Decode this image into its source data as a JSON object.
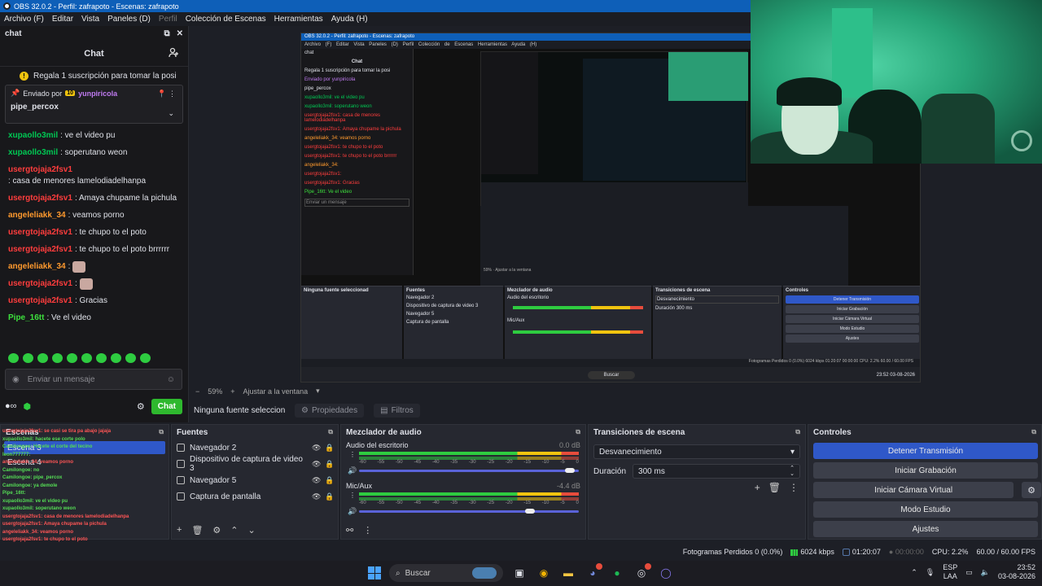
{
  "window": {
    "title": "OBS 32.0.2 - Perfil: zafrapoto - Escenas: zafrapoto"
  },
  "menu": [
    "Archivo (F)",
    "Editar",
    "Vista",
    "Paneles (D)",
    "Perfil",
    "Colección de Escenas",
    "Herramientas",
    "Ayuda (H)"
  ],
  "chat": {
    "dock_title": "chat",
    "header": "Chat",
    "gift_text": "Regala 1 suscripción para tomar la posi",
    "pinned": {
      "label": "Enviado por",
      "sub_badge": "10",
      "by": "yunpiricola",
      "user": "pipe_percox"
    },
    "messages": [
      {
        "user": "xupaollo3mil",
        "color": "#00c853",
        "text": ": ve el video pu"
      },
      {
        "user": "xupaollo3mil",
        "color": "#00c853",
        "text": ": soperutano weon"
      },
      {
        "user": "usergtojaja2fsv1",
        "color": "#ff3d3d",
        "text": ": casa de menores lamelodiadelhanpa"
      },
      {
        "user": "usergtojaja2fsv1",
        "color": "#ff3d3d",
        "text": ": Amaya chupame la pichula"
      },
      {
        "user": "angeleliakk_34",
        "color": "#ff9a2e",
        "text": ": veamos porno"
      },
      {
        "user": "usergtojaja2fsv1",
        "color": "#ff3d3d",
        "text": ": te chupo to el poto"
      },
      {
        "user": "usergtojaja2fsv1",
        "color": "#ff3d3d",
        "text": ": te chupo to el poto brrrrrr"
      },
      {
        "user": "angeleliakk_34",
        "color": "#ff9a2e",
        "text": ":",
        "emote": true
      },
      {
        "user": "usergtojaja2fsv1",
        "color": "#ff3d3d",
        "text": ":",
        "emote": true
      },
      {
        "user": "usergtojaja2fsv1",
        "color": "#ff3d3d",
        "text": ": Gracias"
      },
      {
        "user": "Pipe_16tt",
        "color": "#3de03d",
        "text": ": Ve el video"
      }
    ],
    "input_placeholder": "Enviar un mensaje",
    "chat_button": "Chat"
  },
  "zoom": {
    "value": "59%",
    "fit_label": "Ajustar a la ventana"
  },
  "context_bar": {
    "no_source": "Ninguna fuente seleccionad",
    "properties": "Propiedades",
    "filters": "Filtros"
  },
  "scenes": {
    "title": "Escenas",
    "items": [
      "Escena 3",
      "Escena 4"
    ],
    "selected": 0
  },
  "sources": {
    "title": "Fuentes",
    "items": [
      "Navegador 2",
      "Dispositivo de captura de video 3",
      "Navegador 5",
      "Captura de pantalla"
    ]
  },
  "mixer": {
    "title": "Mezclador de audio",
    "tracks": [
      {
        "name": "Audio del escritorio",
        "db": "0.0 dB",
        "level": 0.72,
        "volume": 0.98
      },
      {
        "name": "Mic/Aux",
        "db": "-4.4 dB",
        "level": 0.88,
        "volume": 0.8
      }
    ],
    "ticks": [
      "-60",
      "-55",
      "-50",
      "-45",
      "-40",
      "-35",
      "-30",
      "-25",
      "-20",
      "-15",
      "-10",
      "-5",
      "0"
    ]
  },
  "transitions": {
    "title": "Transiciones de escena",
    "selected": "Desvanecimiento",
    "duration_label": "Duración",
    "duration_value": "300 ms"
  },
  "controls": {
    "title": "Controles",
    "buttons": [
      "Detener Transmisión",
      "Iniciar Grabación",
      "Iniciar Cámara Virtual",
      "Modo Estudio",
      "Ajustes"
    ]
  },
  "status": {
    "dropped": "Fotogramas Perdidos 0 (0.0%)",
    "bitrate": "6024 kbps",
    "stream_time": "01:20:07",
    "rec_time": "00:00:00",
    "cpu": "CPU: 2.2%",
    "fps": "60.00 / 60.00 FPS"
  },
  "taskbar": {
    "search": "Buscar",
    "lang_top": "ESP",
    "lang_bottom": "LAA",
    "time": "23:52",
    "date": "03-08-2026"
  },
  "nested": {
    "title": "OBS 32.0.2 - Perfil: zafrapoto - Escenas: zafrapoto",
    "menu": "Archivo (F) Editar Vista Paneles (D) Perfil Colección de Escenas Herramientas Ayuda (H)",
    "chat_lines": [
      "chat",
      "Chat",
      "Regala 1 suscripción para tomar la posi",
      "Enviado por yunpiricola",
      "pipe_percox",
      "xupaollo3mil: ve el video pu",
      "xupaollo3mil: soperutano weon",
      "usergtojaja2fsv1: casa de menores lamelodiadelhanpa",
      "usergtojaja2fsv1: Amaya chupame la pichula",
      "angeleliakk_34: veamos porno",
      "usergtojaja2fsv1: te chupo to el poto",
      "usergtojaja2fsv1: te chupo to el poto brrrrrr",
      "angeleliakk_34:",
      "usergtojaja2fsv1:",
      "usergtojaja2fsv1: Gracias",
      "Pipe_16tt: Ve el video",
      "Enviar un mensaje"
    ],
    "zoom": "59%",
    "fit_label": "Ajustar a la ventana",
    "no_source": "Ninguna fuente seleccionad",
    "properties": "Propiedades",
    "filters": "Filtros",
    "sources_title": "Fuentes",
    "sources": [
      "Navegador 2",
      "Dispositivo de captura de video 3",
      "Navegador 5",
      "Captura de pantalla"
    ],
    "mixer_title": "Mezclador de audio",
    "tracks": [
      "Audio del escritorio",
      "Mic/Aux"
    ],
    "trans_title": "Transiciones de escena",
    "trans_selected": "Desvanecimiento",
    "duration": "Duración",
    "duration_value": "300 ms",
    "controls_title": "Controles",
    "buttons": [
      "Detener Transmisión",
      "Iniciar Grabación",
      "Iniciar Cámara Virtual",
      "Modo Estudio",
      "Ajustes"
    ],
    "status": "Fotogramas Perdidos 0 (0.0%)  6024 kbps  01:20:07  00:00:00  CPU: 2.2%  60.00 / 60.00 FPS",
    "search": "Buscar",
    "time": "23:52",
    "date": "03-08-2026"
  },
  "scene_overlay": [
    {
      "c": "r",
      "t": "usergtojaja2fsv1: se casi se tira pa abajo jajaja"
    },
    {
      "c": "g",
      "t": "xupaollo3mil: hacete ese corte polo"
    },
    {
      "c": "g",
      "t": "Camilongoe: Hacete el corte del tecino"
    },
    {
      "c": "g",
      "t": "leon777777:"
    },
    {
      "c": "r",
      "t": "angeleliakk_34: veamos porno"
    },
    {
      "c": "g",
      "t": "Camilongoe: no"
    },
    {
      "c": "g",
      "t": "Camilongoe: pipe_percox"
    },
    {
      "c": "g",
      "t": "Camilongoe: ya demole"
    },
    {
      "c": "g",
      "t": "Pipe_16tt:"
    },
    {
      "c": "g",
      "t": "xupaollo3mil: ve el video pu"
    },
    {
      "c": "g",
      "t": "xupaollo3mil: soperutano weon"
    },
    {
      "c": "r",
      "t": "usergtojaja2fsv1: casa de menores lamelodiadelhanpa"
    },
    {
      "c": "r",
      "t": "usergtojaja2fsv1: Amaya chupame la pichula"
    },
    {
      "c": "r",
      "t": "angeleliakk_34: veamos porno"
    },
    {
      "c": "r",
      "t": "usergtojaja2fsv1: te chupo to el poto"
    },
    {
      "c": "r",
      "t": "usergtojaja2fsv1: te chupo to el poto brrrrrr"
    },
    {
      "c": "r",
      "t": "angeleliakk_34:"
    },
    {
      "c": "r",
      "t": "usergtojaja2fsv1:"
    },
    {
      "c": "r",
      "t": "usergtojaja2fsv1: Gracias"
    },
    {
      "c": "g",
      "t": "Pipe_16tt: Ve el video"
    }
  ],
  "colors": {
    "accent": "#2f58c8",
    "titlebar": "#0e5fb8",
    "chat_green": "#2eb82e"
  }
}
